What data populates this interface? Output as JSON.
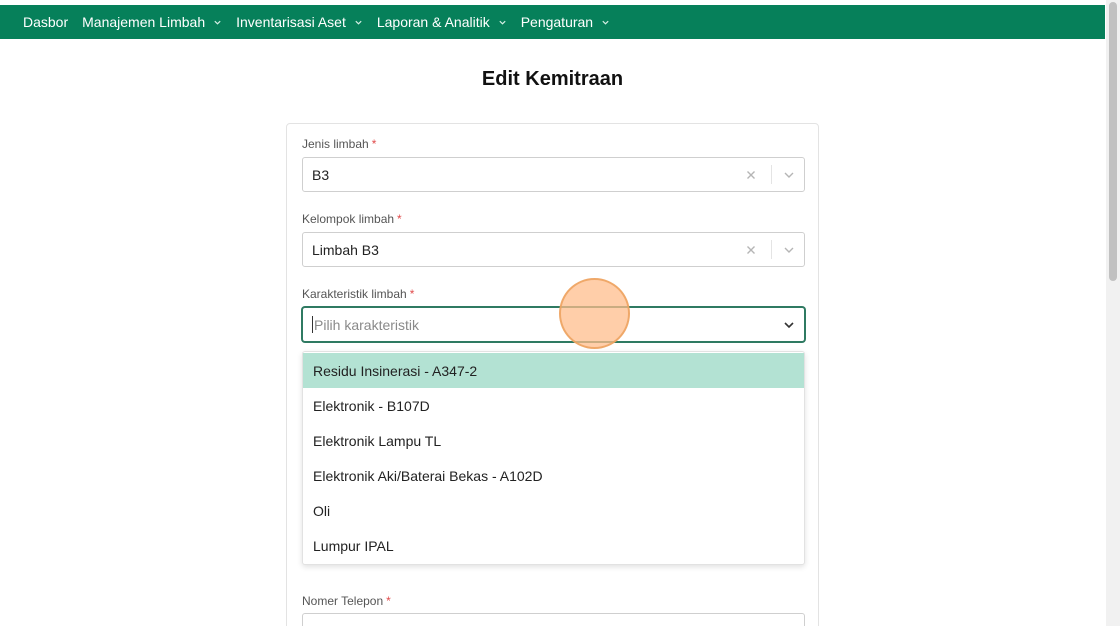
{
  "nav": {
    "items": [
      {
        "label": "Dasbor",
        "has_dropdown": false
      },
      {
        "label": "Manajemen Limbah",
        "has_dropdown": true
      },
      {
        "label": "Inventarisasi Aset",
        "has_dropdown": true
      },
      {
        "label": "Laporan & Analitik",
        "has_dropdown": true
      },
      {
        "label": "Pengaturan",
        "has_dropdown": true
      }
    ],
    "background": "#06805a",
    "dropdown_icon": "chevron-down-icon"
  },
  "page": {
    "title": "Edit Kemitraan"
  },
  "form": {
    "required_mark": "*",
    "jenis": {
      "label": "Jenis limbah",
      "value": "B3"
    },
    "kelompok": {
      "label": "Kelompok limbah",
      "value": "Limbah B3"
    },
    "karakteristik": {
      "label": "Karakteristik limbah",
      "placeholder": "Pilih karakteristik",
      "options": [
        "Residu Insinerasi - A347-2",
        "Elektronik - B107D",
        "Elektronik Lampu TL",
        "Elektronik Aki/Baterai Bekas - A102D",
        "Oli",
        "Lumpur IPAL"
      ],
      "highlighted_option": "Residu Insinerasi - A347-2"
    },
    "telepon": {
      "label": "Nomer Telepon"
    }
  },
  "colors": {
    "accent": "#06805a",
    "option_highlight": "#b3e2d3",
    "focus_border": "#2f7a62",
    "required": "#e04b4b"
  }
}
